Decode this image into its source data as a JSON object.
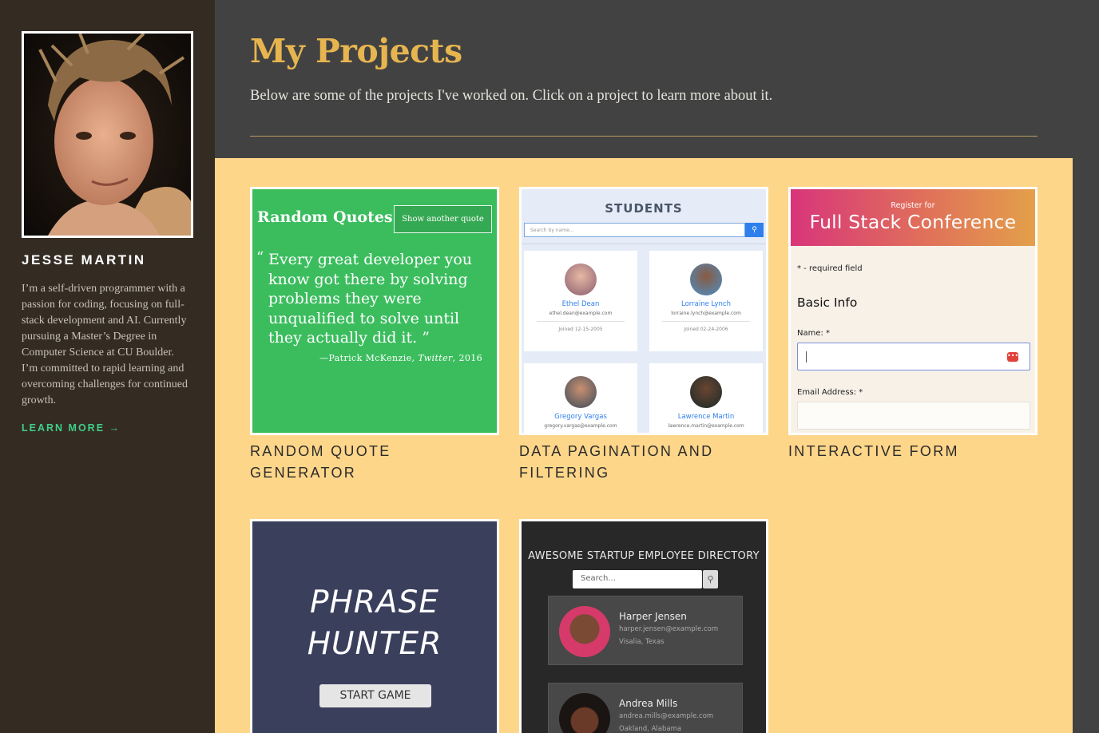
{
  "sidebar": {
    "name": "JESSE MARTIN",
    "bio": "I’m a self-driven programmer with a passion for coding, focusing on full-stack development and AI. Currently pursuing a Master’s Degree in Computer Science at CU Boulder. I’m committed to rapid learning and overcoming challenges for continued growth.",
    "learn_more": "LEARN MORE →"
  },
  "header": {
    "title": "My Projects",
    "subtitle": "Below are some of the projects I've worked on. Click on a project to learn more about it."
  },
  "projects": [
    {
      "title": "RANDOM QUOTE GENERATOR",
      "thumb": {
        "heading": "Random Quotes",
        "button": "Show another quote",
        "open_mark": "“",
        "quote": "Every great developer you know got there by solving problems they were unqualified to solve until they actually did it.",
        "close_mark": "”",
        "author": "—Patrick McKenzie,",
        "source": "Twitter",
        "year": ", 2016"
      }
    },
    {
      "title": "DATA PAGINATION AND FILTERING",
      "thumb": {
        "heading": "STUDENTS",
        "search_placeholder": "Search by name...",
        "students": [
          {
            "name": "Ethel Dean",
            "email": "ethel.dean@example.com",
            "joined": "Joined 12-15-2005"
          },
          {
            "name": "Lorraine Lynch",
            "email": "lorraine.lynch@example.com",
            "joined": "Joined 02-24-2006"
          },
          {
            "name": "Gregory Vargas",
            "email": "gregory.vargas@example.com"
          },
          {
            "name": "Lawrence Martin",
            "email": "lawrence.martin@example.com"
          }
        ]
      }
    },
    {
      "title": "INTERACTIVE FORM",
      "thumb": {
        "register_for": "Register for",
        "conference": "Full Stack Conference",
        "required_note": "* - required field",
        "section": "Basic Info",
        "name_label": "Name: *",
        "email_label": "Email Address: *"
      }
    },
    {
      "title": "",
      "thumb": {
        "line1": "PHRASE",
        "line2": "HUNTER",
        "button": "START GAME"
      }
    },
    {
      "title": "",
      "thumb": {
        "heading": "AWESOME STARTUP EMPLOYEE DIRECTORY",
        "search_placeholder": "Search...",
        "employees": [
          {
            "name": "Harper Jensen",
            "email": "harper.jensen@example.com",
            "location": "Visalia, Texas"
          },
          {
            "name": "Andrea Mills",
            "email": "andrea.mills@example.com",
            "location": "Oakland, Alabama"
          }
        ]
      }
    }
  ],
  "colors": {
    "accent_gold": "#e7b550",
    "panel": "#fed68a",
    "link_green": "#3fcf8a"
  }
}
